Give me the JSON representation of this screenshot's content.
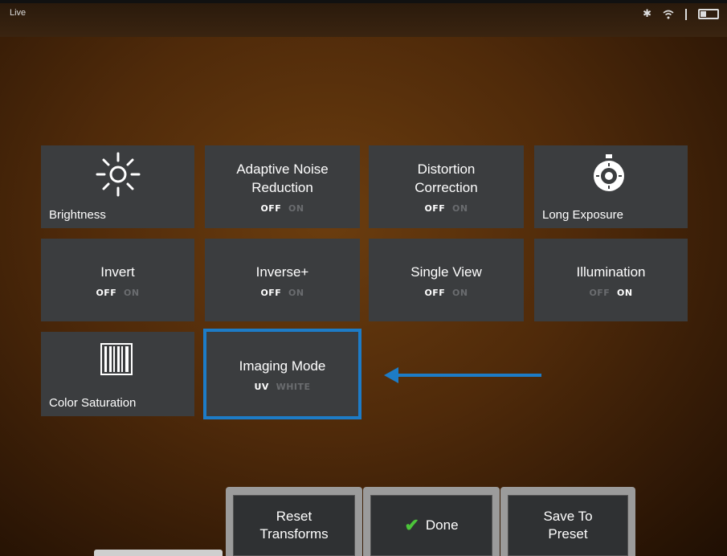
{
  "status_bar": {
    "title": "Live"
  },
  "tiles": {
    "brightness": {
      "label": "Brightness"
    },
    "adaptive_noise": {
      "title_line1": "Adaptive Noise",
      "title_line2": "Reduction",
      "off": "OFF",
      "on": "ON"
    },
    "distortion": {
      "title_line1": "Distortion",
      "title_line2": "Correction",
      "off": "OFF",
      "on": "ON"
    },
    "long_exposure": {
      "label": "Long Exposure"
    },
    "invert": {
      "title": "Invert",
      "off": "OFF",
      "on": "ON"
    },
    "inverse_plus": {
      "title": "Inverse+",
      "off": "OFF",
      "on": "ON"
    },
    "single_view": {
      "title": "Single View",
      "off": "OFF",
      "on": "ON"
    },
    "illumination": {
      "title": "Illumination",
      "off": "OFF",
      "on": "ON"
    },
    "color_saturation": {
      "label": "Color Saturation"
    },
    "imaging_mode": {
      "title": "Imaging Mode",
      "uv": "UV",
      "white": "WHITE"
    }
  },
  "bottom": {
    "reset_line1": "Reset",
    "reset_line2": "Transforms",
    "done": "Done",
    "save_line1": "Save To",
    "save_line2": "Preset"
  },
  "colors": {
    "highlight": "#1d7cc7",
    "tile": "#3b3d3f",
    "check": "#4cc43a"
  }
}
